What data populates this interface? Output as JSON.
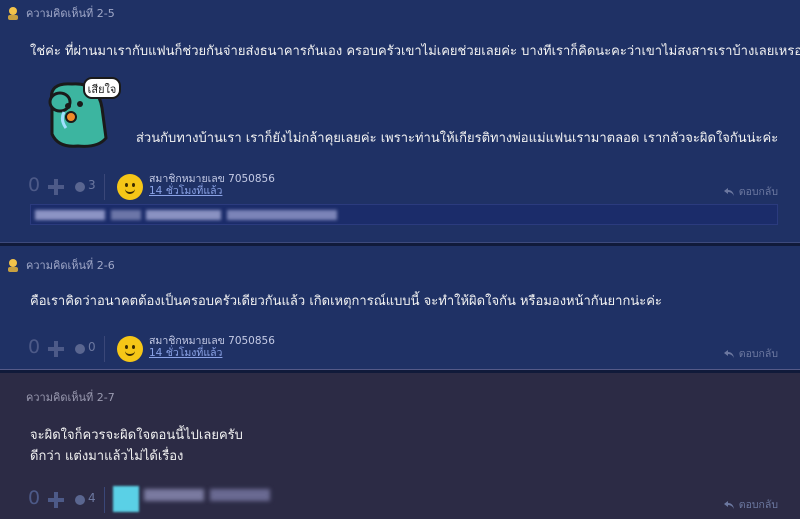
{
  "comments": [
    {
      "number": "ความคิดเห็นที่ 2-5",
      "lines": [
        "ใช่ค่ะ ที่ผ่านมาเรากับแฟนก็ช่วยกันจ่ายส่งธนาคารกันเอง ครอบครัวเขาไม่เคยช่วยเลยค่ะ บางทีเราก็คิดนะคะว่าเขาไม่สงสารเราบ้างเลยเหรอคะ",
        "ส่วนกับทางบ้านเรา เราก็ยังไม่กล้าคุยเลยค่ะ เพราะท่านให้เกียรติทางพ่อแม่แฟนเรามาตลอด เรากลัวจะผิดใจกันน่ะค่ะ"
      ],
      "sticker_text": "เสียใจ",
      "votes": "0",
      "emotions": "3",
      "member": "สมาชิกหมายเลข 7050856",
      "time": "14 ชั่วโมงที่แล้ว",
      "reply": "ตอบกลับ"
    },
    {
      "number": "ความคิดเห็นที่ 2-6",
      "lines": [
        "คือเราคิดว่าอนาคตต้องเป็นครอบครัวเดียวกันแล้ว เกิดเหตุการณ์แบบนี้ จะทำให้ผิดใจกัน หรือมองหน้ากันยากน่ะค่ะ"
      ],
      "votes": "0",
      "emotions": "0",
      "member": "สมาชิกหมายเลข 7050856",
      "time": "14 ชั่วโมงที่แล้ว",
      "reply": "ตอบกลับ"
    },
    {
      "number": "ความคิดเห็นที่ 2-7",
      "lines": [
        "จะผิดใจก็ควรจะผิดใจตอนนี้ไปเลยครับ",
        "ดีกว่า แต่งมาแล้วไม่ได้เรื่อง"
      ],
      "votes": "0",
      "emotions": "4",
      "reply": "ตอบกลับ"
    }
  ],
  "colors": {
    "background": "#1f3165",
    "background_alt": "#2c2b45",
    "avatar": "#f5c617",
    "link": "#8aa2e6"
  }
}
